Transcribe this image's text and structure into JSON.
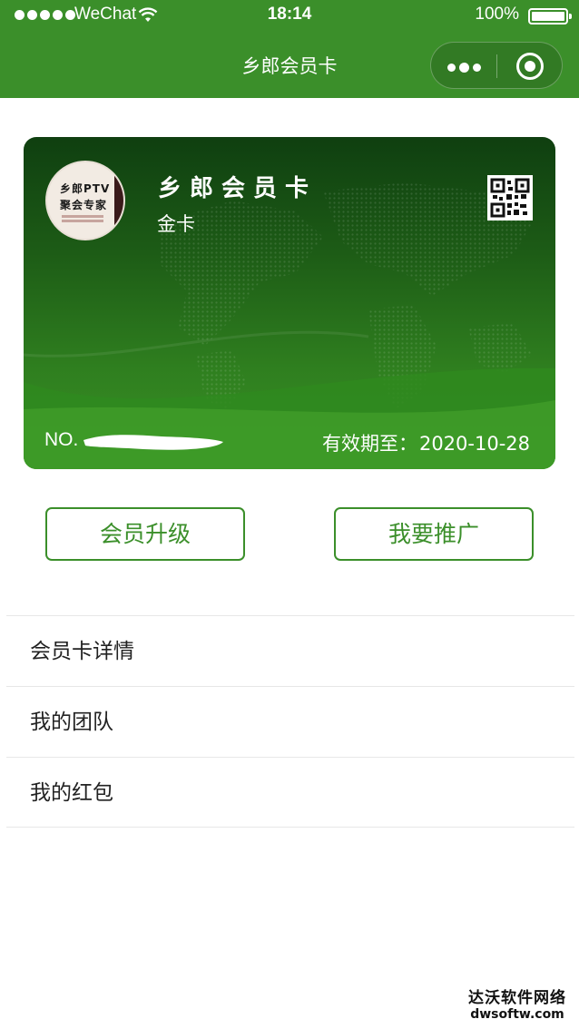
{
  "status_bar": {
    "carrier": "WeChat",
    "time": "18:14",
    "battery": "100%"
  },
  "nav": {
    "title": "乡郎会员卡",
    "icons": [
      "more-icon",
      "close-icon"
    ]
  },
  "card": {
    "logo_line1": "乡郎PTV",
    "logo_line2": "聚会专家",
    "name": "乡郎会员卡",
    "level": "金卡",
    "number_prefix": "NO.",
    "expiry_label": "有效期至：",
    "expiry_date": "2020-10-28",
    "colors": {
      "card_dark": "#0f3f10",
      "card_light": "#3a9126"
    }
  },
  "buttons": {
    "upgrade": "会员升级",
    "promote": "我要推广"
  },
  "menu": {
    "items": [
      {
        "label": "会员卡详情"
      },
      {
        "label": "我的团队"
      },
      {
        "label": "我的红包"
      }
    ]
  },
  "watermark": {
    "line1": "达沃软件网络",
    "line2": "dwsoftw.com"
  },
  "theme": {
    "accent": "#3b8f2a",
    "divider": "#e7e7e7"
  }
}
